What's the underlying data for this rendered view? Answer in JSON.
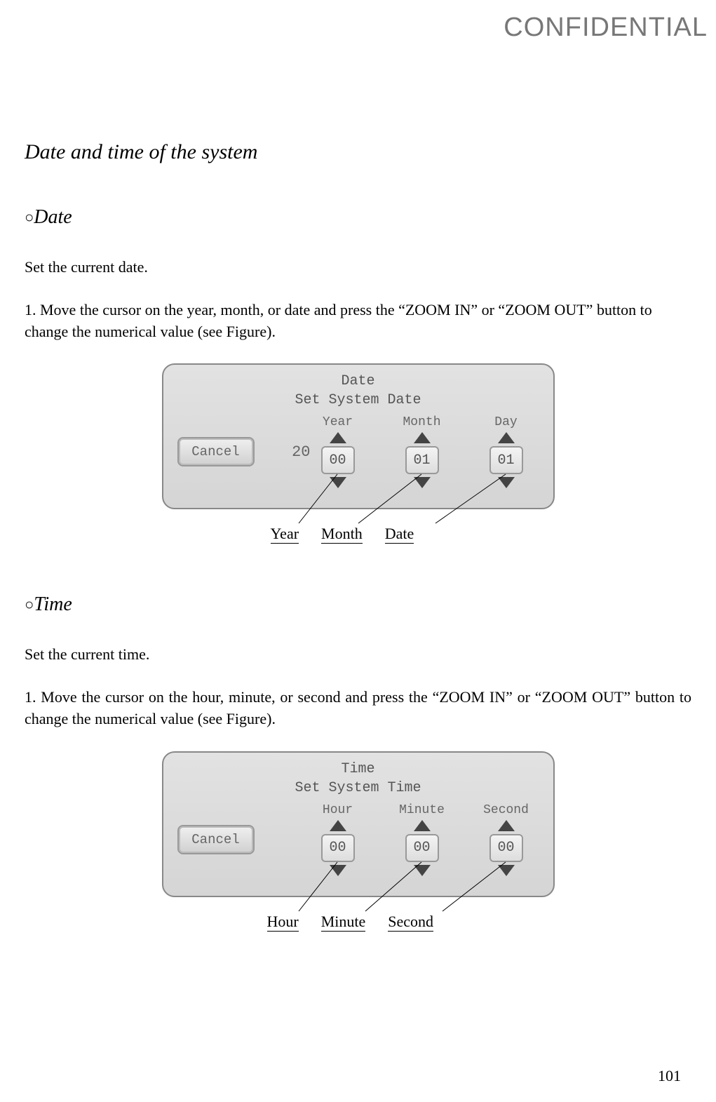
{
  "watermark": "CONFIDENTIAL",
  "main_title": "Date and time of the system",
  "date": {
    "heading": "Date",
    "intro": "Set the current date.",
    "step": "1. Move the cursor on the year, month, or date and press the “ZOOM IN” or “ZOOM OUT” button to change the numerical value (see Figure).",
    "panel": {
      "title": "Date",
      "subtitle": "Set System Date",
      "cancel": "Cancel",
      "prefix": "20",
      "fields": [
        {
          "label": "Year",
          "value": "00"
        },
        {
          "label": "Month",
          "value": "01"
        },
        {
          "label": "Day",
          "value": "01"
        }
      ]
    },
    "callouts": [
      "Year",
      "Month",
      "Date"
    ]
  },
  "time": {
    "heading": "Time",
    "intro": "Set the current time.",
    "step": "1. Move the cursor on the hour, minute, or second and press the “ZOOM IN” or “ZOOM OUT” button to change the numerical value (see Figure).",
    "panel": {
      "title": "Time",
      "subtitle": "Set System Time",
      "cancel": "Cancel",
      "fields": [
        {
          "label": "Hour",
          "value": "00"
        },
        {
          "label": "Minute",
          "value": "00"
        },
        {
          "label": "Second",
          "value": "00"
        }
      ]
    },
    "callouts": [
      "Hour",
      "Minute",
      "Second"
    ]
  },
  "page_number": "101"
}
